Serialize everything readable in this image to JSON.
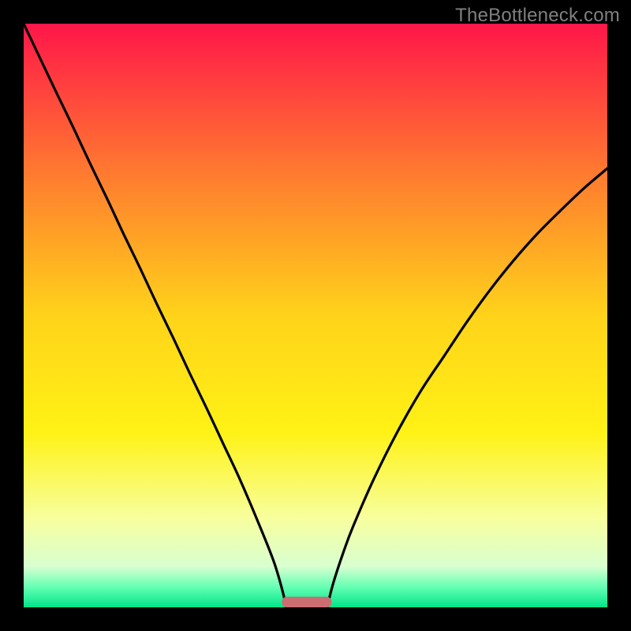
{
  "watermark": "TheBottleneck.com",
  "chart_data": {
    "type": "line",
    "title": "",
    "xlabel": "",
    "ylabel": "",
    "xlim": [
      0,
      1
    ],
    "ylim": [
      0,
      1
    ],
    "grid": false,
    "legend": false,
    "gradient_stops": [
      {
        "offset": 0.0,
        "color": "#ff1649"
      },
      {
        "offset": 0.25,
        "color": "#ff7830"
      },
      {
        "offset": 0.5,
        "color": "#ffd31a"
      },
      {
        "offset": 0.7,
        "color": "#fff215"
      },
      {
        "offset": 0.85,
        "color": "#f7ffa0"
      },
      {
        "offset": 0.93,
        "color": "#d8ffd0"
      },
      {
        "offset": 0.965,
        "color": "#66ffb3"
      },
      {
        "offset": 1.0,
        "color": "#00e58a"
      }
    ],
    "curves": {
      "left": {
        "x": [
          0.0,
          0.0285,
          0.057,
          0.086,
          0.114,
          0.143,
          0.171,
          0.2,
          0.228,
          0.257,
          0.285,
          0.314,
          0.342,
          0.371,
          0.4,
          0.428,
          0.443,
          0.45
        ],
        "y": [
          1.0,
          0.94,
          0.88,
          0.82,
          0.76,
          0.7,
          0.64,
          0.58,
          0.52,
          0.46,
          0.4,
          0.34,
          0.28,
          0.218,
          0.15,
          0.08,
          0.03,
          0.0
        ]
      },
      "right": {
        "x": [
          0.52,
          0.53,
          0.548,
          0.565,
          0.6,
          0.64,
          0.68,
          0.72,
          0.76,
          0.8,
          0.84,
          0.88,
          0.92,
          0.96,
          1.0
        ],
        "y": [
          0.0,
          0.04,
          0.095,
          0.14,
          0.22,
          0.3,
          0.37,
          0.43,
          0.49,
          0.545,
          0.595,
          0.64,
          0.68,
          0.718,
          0.752
        ]
      }
    },
    "marker": {
      "type": "rounded-bar",
      "color": "#cc6d72",
      "x_center": 0.485,
      "y": 0.0,
      "width_frac": 0.085,
      "height_frac": 0.018
    },
    "series": [
      {
        "name": "left-curve",
        "x": "curves.left.x",
        "y": "curves.left.y"
      },
      {
        "name": "right-curve",
        "x": "curves.right.x",
        "y": "curves.right.y"
      }
    ]
  }
}
